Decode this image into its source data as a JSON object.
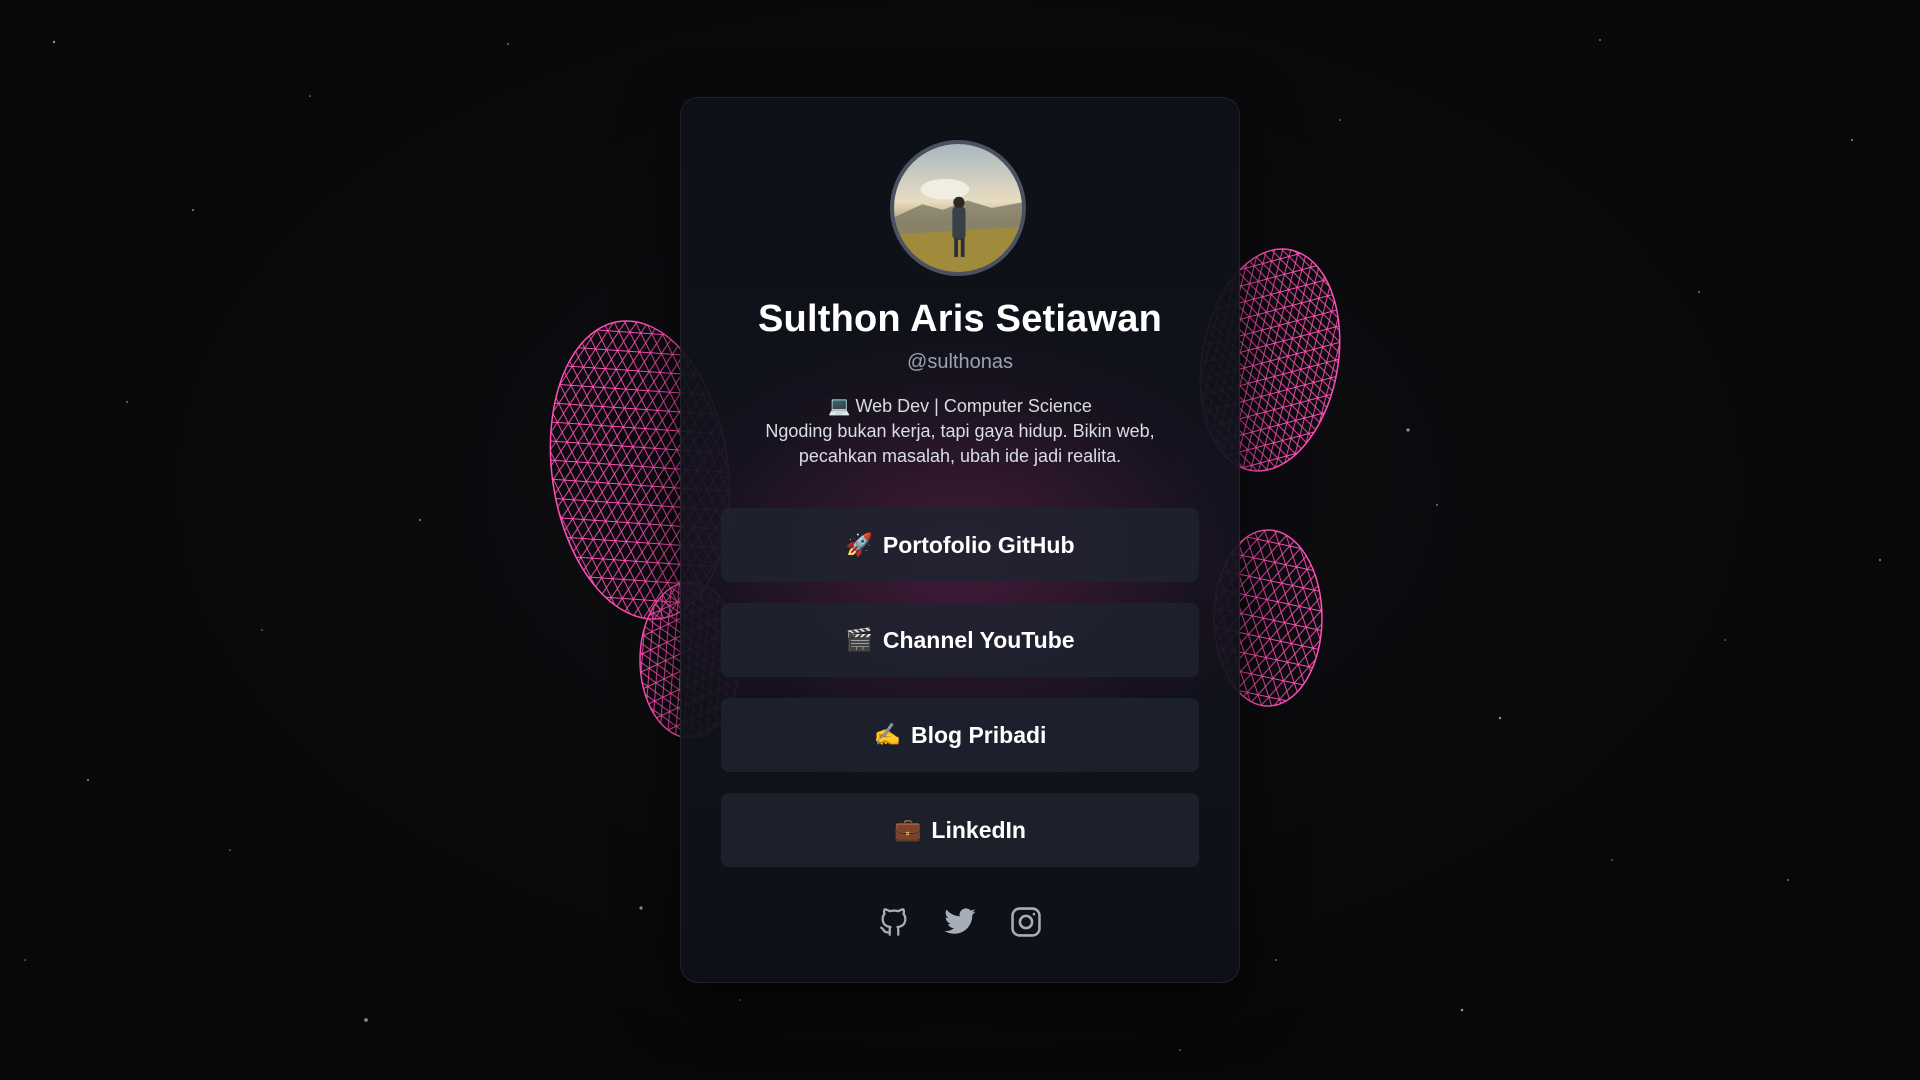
{
  "profile": {
    "name": "Sulthon Aris Setiawan",
    "handle": "@sulthonas",
    "bio_line1": "💻 Web Dev | Computer Science",
    "bio_line2": "Ngoding bukan kerja, tapi gaya hidup. Bikin web, pecahkan masalah, ubah ide jadi realita."
  },
  "links": [
    {
      "emoji": "🚀",
      "label": "Portofolio GitHub"
    },
    {
      "emoji": "🎬",
      "label": "Channel YouTube"
    },
    {
      "emoji": "✍️",
      "label": "Blog Pribadi"
    },
    {
      "emoji": "💼",
      "label": "LinkedIn"
    }
  ],
  "socials": [
    {
      "icon": "github-icon"
    },
    {
      "icon": "twitter-icon"
    },
    {
      "icon": "instagram-icon"
    }
  ],
  "colors": {
    "background": "#0a0a0b",
    "mesh": "#ff4fb8",
    "card": "#0e1118",
    "button": "#1e2330",
    "text_muted": "#9aa3b2"
  }
}
